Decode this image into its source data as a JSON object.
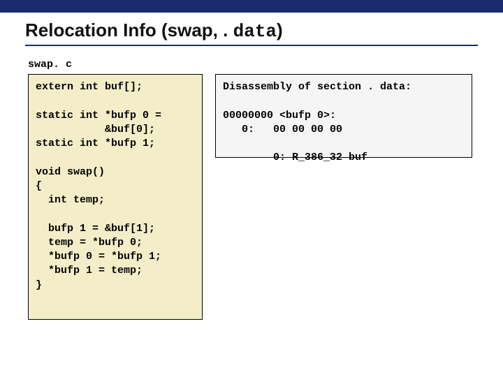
{
  "title_prefix": "Relocation Info (swap, . ",
  "title_mono": "data",
  "title_suffix": ")",
  "file_label": "swap. c",
  "source_code": "extern int buf[];\n\nstatic int *bufp 0 =\n           &buf[0];\nstatic int *bufp 1;\n\nvoid swap()\n{\n  int temp;\n\n  bufp 1 = &buf[1];\n  temp = *bufp 0;\n  *bufp 0 = *bufp 1;\n  *bufp 1 = temp;\n}",
  "disasm": "Disassembly of section . data:\n\n00000000 <bufp 0>:\n   0:   00 00 00 00\n\n        0: R_386_32 buf"
}
